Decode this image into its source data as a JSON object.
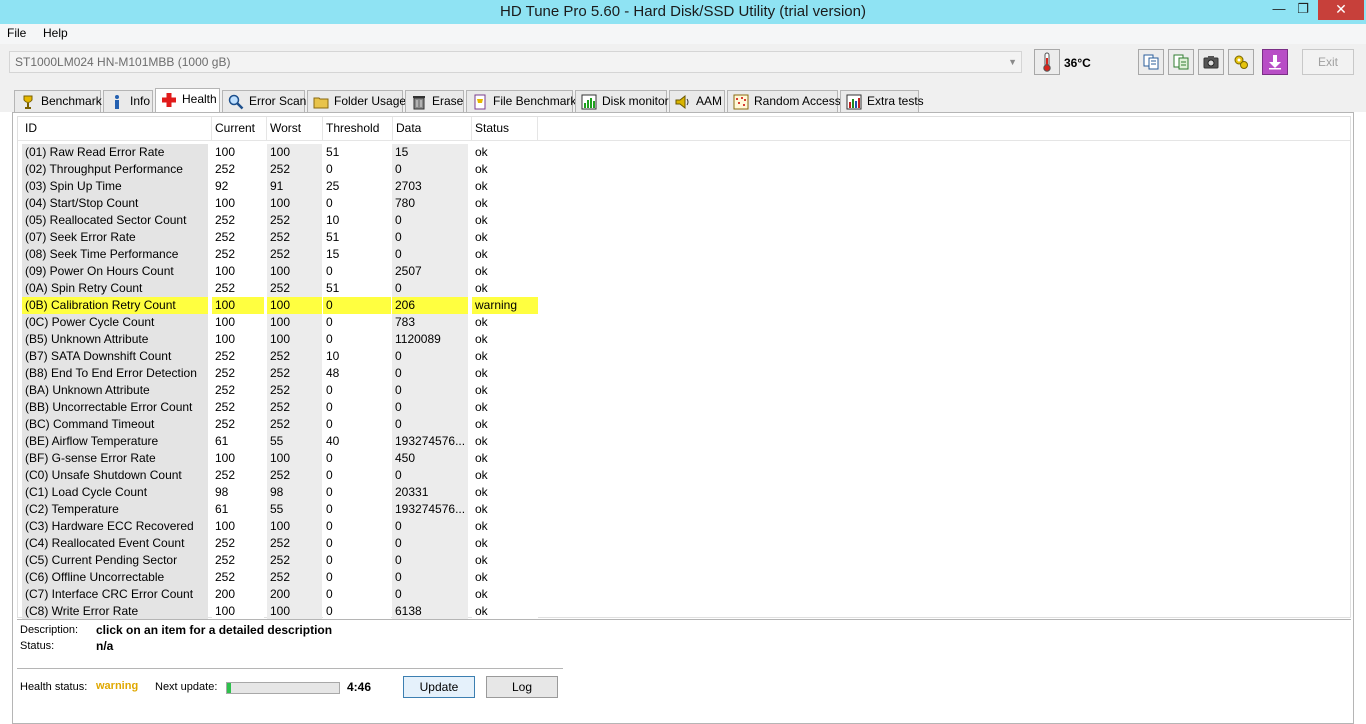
{
  "window": {
    "title": "HD Tune Pro 5.60 - Hard Disk/SSD Utility (trial version)",
    "min": "—",
    "max": "❐",
    "close": "✕"
  },
  "menu": {
    "file": "File",
    "help": "Help"
  },
  "toolbar": {
    "drive": "ST1000LM024 HN-M101MBB (1000 gB)",
    "temperature": "36°C",
    "exit_label": "Exit"
  },
  "tabs": [
    {
      "label": "Benchmark",
      "icon": "benchmark-icon"
    },
    {
      "label": "Info",
      "icon": "info-icon"
    },
    {
      "label": "Health",
      "icon": "health-cross-icon"
    },
    {
      "label": "Error Scan",
      "icon": "magnifier-icon"
    },
    {
      "label": "Folder Usage",
      "icon": "folder-icon"
    },
    {
      "label": "Erase",
      "icon": "trash-icon"
    },
    {
      "label": "File Benchmark",
      "icon": "file-benchmark-icon"
    },
    {
      "label": "Disk monitor",
      "icon": "disk-monitor-icon"
    },
    {
      "label": "AAM",
      "icon": "speaker-icon"
    },
    {
      "label": "Random Access",
      "icon": "random-access-icon"
    },
    {
      "label": "Extra tests",
      "icon": "extra-tests-icon"
    }
  ],
  "table": {
    "headers": [
      "ID",
      "Current",
      "Worst",
      "Threshold",
      "Data",
      "Status"
    ],
    "rows": [
      [
        "(01) Raw Read Error Rate",
        "100",
        "100",
        "51",
        "15",
        "ok"
      ],
      [
        "(02) Throughput Performance",
        "252",
        "252",
        "0",
        "0",
        "ok"
      ],
      [
        "(03) Spin Up Time",
        "92",
        "91",
        "25",
        "2703",
        "ok"
      ],
      [
        "(04) Start/Stop Count",
        "100",
        "100",
        "0",
        "780",
        "ok"
      ],
      [
        "(05) Reallocated Sector Count",
        "252",
        "252",
        "10",
        "0",
        "ok"
      ],
      [
        "(07) Seek Error Rate",
        "252",
        "252",
        "51",
        "0",
        "ok"
      ],
      [
        "(08) Seek Time Performance",
        "252",
        "252",
        "15",
        "0",
        "ok"
      ],
      [
        "(09) Power On Hours Count",
        "100",
        "100",
        "0",
        "2507",
        "ok"
      ],
      [
        "(0A) Spin Retry Count",
        "252",
        "252",
        "51",
        "0",
        "ok"
      ],
      [
        "(0B) Calibration Retry Count",
        "100",
        "100",
        "0",
        "206",
        "warning"
      ],
      [
        "(0C) Power Cycle Count",
        "100",
        "100",
        "0",
        "783",
        "ok"
      ],
      [
        "(B5) Unknown Attribute",
        "100",
        "100",
        "0",
        "1120089",
        "ok"
      ],
      [
        "(B7) SATA Downshift Count",
        "252",
        "252",
        "10",
        "0",
        "ok"
      ],
      [
        "(B8) End To End Error Detection",
        "252",
        "252",
        "48",
        "0",
        "ok"
      ],
      [
        "(BA) Unknown Attribute",
        "252",
        "252",
        "0",
        "0",
        "ok"
      ],
      [
        "(BB) Uncorrectable Error Count",
        "252",
        "252",
        "0",
        "0",
        "ok"
      ],
      [
        "(BC) Command Timeout",
        "252",
        "252",
        "0",
        "0",
        "ok"
      ],
      [
        "(BE) Airflow Temperature",
        "61",
        "55",
        "40",
        "193274576...",
        "ok"
      ],
      [
        "(BF) G-sense Error Rate",
        "100",
        "100",
        "0",
        "450",
        "ok"
      ],
      [
        "(C0) Unsafe Shutdown Count",
        "252",
        "252",
        "0",
        "0",
        "ok"
      ],
      [
        "(C1) Load Cycle Count",
        "98",
        "98",
        "0",
        "20331",
        "ok"
      ],
      [
        "(C2) Temperature",
        "61",
        "55",
        "0",
        "193274576...",
        "ok"
      ],
      [
        "(C3) Hardware ECC Recovered",
        "100",
        "100",
        "0",
        "0",
        "ok"
      ],
      [
        "(C4) Reallocated Event Count",
        "252",
        "252",
        "0",
        "0",
        "ok"
      ],
      [
        "(C5) Current Pending Sector",
        "252",
        "252",
        "0",
        "0",
        "ok"
      ],
      [
        "(C6) Offline Uncorrectable",
        "252",
        "252",
        "0",
        "0",
        "ok"
      ],
      [
        "(C7) Interface CRC Error Count",
        "200",
        "200",
        "0",
        "0",
        "ok"
      ],
      [
        "(C8) Write Error Rate",
        "100",
        "100",
        "0",
        "6138",
        "ok"
      ]
    ]
  },
  "details": {
    "description_label": "Description:",
    "description_value": "click on an item for a detailed description",
    "status_label": "Status:",
    "status_value": "n/a"
  },
  "footer": {
    "health_label": "Health status:",
    "health_value": "warning",
    "next_update_label": "Next update:",
    "next_update_progress": 0.04,
    "next_update_time": "4:46",
    "update_button": "Update",
    "log_button": "Log"
  }
}
